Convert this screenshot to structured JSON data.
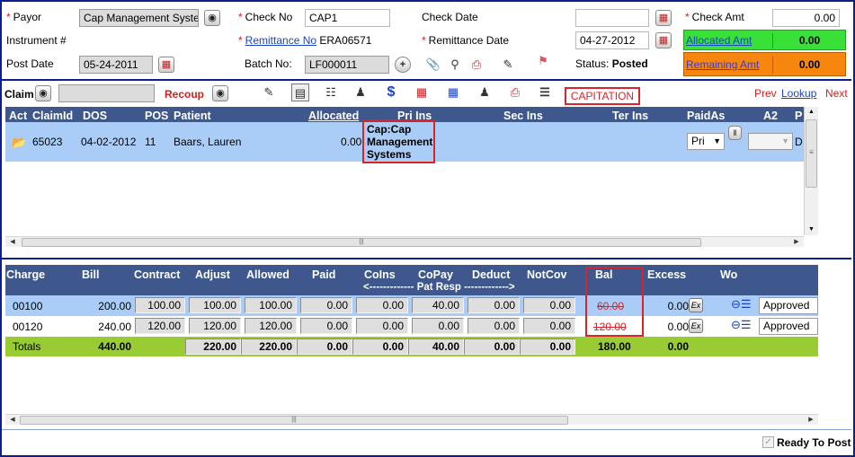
{
  "header": {
    "payor_label": "Payor",
    "payor_value": "Cap Management Syste",
    "check_no_label": "Check No",
    "check_no_value": "CAP1",
    "check_date_label": "Check Date",
    "check_date_value": "",
    "check_amt_label": "Check Amt",
    "check_amt_value": "0.00",
    "instrument_label": "Instrument #",
    "remittance_no_label": "Remittance No",
    "remittance_no_value": "ERA06571",
    "remittance_date_label": "Remittance Date",
    "remittance_date_value": "04-27-2012",
    "allocated_amt_label": "Allocated Amt",
    "allocated_amt_value": "0.00",
    "post_date_label": "Post Date",
    "post_date_value": "05-24-2011",
    "batch_no_label": "Batch No:",
    "batch_no_value": "LF000011",
    "status_label": "Status:",
    "status_value": "Posted",
    "remaining_amt_label": "Remaining Amt",
    "remaining_amt_value": "0.00"
  },
  "toolbar": {
    "claim_label": "Claim",
    "claim_value": "",
    "recoup_label": "Recoup",
    "capitation_label": "CAPITATION",
    "prev_label": "Prev",
    "lookup_label": "Lookup",
    "next_label": "Next"
  },
  "claims": {
    "columns": [
      "Act",
      "ClaimId",
      "DOS",
      "POS",
      "Patient",
      "Allocated",
      "Pri Ins",
      "Sec Ins",
      "Ter Ins",
      "PaidAs",
      "A2",
      "P"
    ],
    "row": {
      "claim_id": "65023",
      "dos": "04-02-2012",
      "pos": "11",
      "patient": "Baars, Lauren",
      "allocated": "0.00",
      "pri_ins": "Cap:Cap Management Systems",
      "paid_as": "Pri",
      "last": "D"
    }
  },
  "charges": {
    "columns": [
      "Charge",
      "Bill",
      "Contract",
      "Adjust",
      "Allowed",
      "Paid",
      "CoIns",
      "CoPay",
      "Deduct",
      "NotCov",
      "Bal",
      "Excess",
      "Wo"
    ],
    "pat_resp_label": "<------------- Pat Resp ------------->",
    "rows": [
      {
        "charge": "00100",
        "bill": "200.00",
        "contract": "100.00",
        "adjust": "100.00",
        "allowed": "100.00",
        "paid": "0.00",
        "coins": "0.00",
        "copay": "40.00",
        "deduct": "0.00",
        "notcov": "0.00",
        "bal": "60.00",
        "excess": "0.00",
        "excess_btn": "Ex",
        "status": "Approved"
      },
      {
        "charge": "00120",
        "bill": "240.00",
        "contract": "120.00",
        "adjust": "120.00",
        "allowed": "120.00",
        "paid": "0.00",
        "coins": "0.00",
        "copay": "0.00",
        "deduct": "0.00",
        "notcov": "0.00",
        "bal": "120.00",
        "excess": "0.00",
        "excess_btn": "Ex",
        "status": "Approved"
      }
    ],
    "totals": {
      "label": "Totals",
      "bill": "440.00",
      "adjust": "220.00",
      "allowed": "220.00",
      "paid": "0.00",
      "coins": "0.00",
      "copay": "40.00",
      "deduct": "0.00",
      "notcov": "0.00",
      "bal": "180.00",
      "excess": "0.00"
    }
  },
  "footer": {
    "ready_to_post_label": "Ready To Post",
    "ready_to_post_checked": true
  },
  "colors": {
    "header_bg": "#3e578d",
    "allocated_green": "#38e038",
    "remaining_orange": "#f7860f",
    "totals_green": "#99cc33",
    "selected_row": "#a9cdf7",
    "border_blue": "#0b1f8f",
    "highlight_red": "#d9252a"
  }
}
